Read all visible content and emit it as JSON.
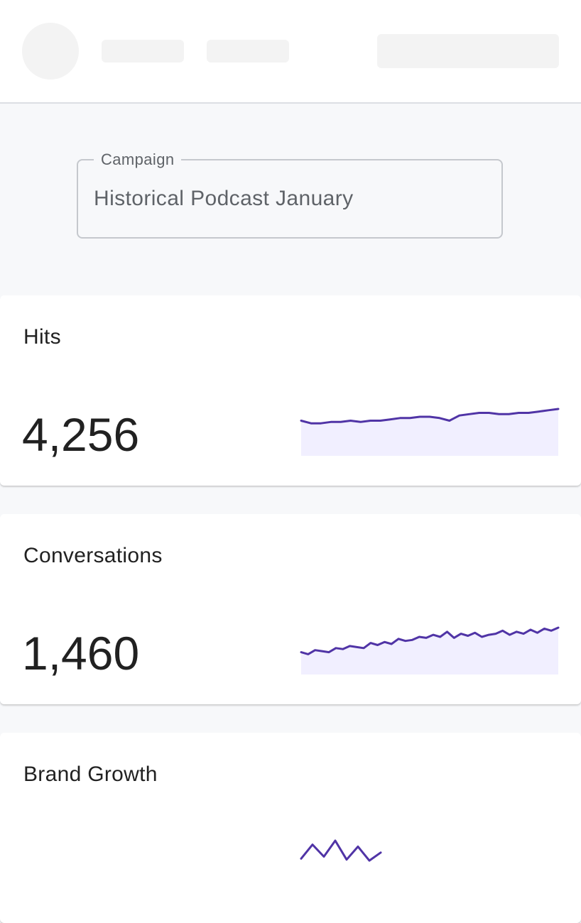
{
  "campaign_field": {
    "label": "Campaign",
    "value": "Historical Podcast January"
  },
  "accent_color": "#5034a6",
  "area_fill_color": "#f1efff",
  "metrics": [
    {
      "title": "Hits",
      "value": "4,256",
      "trend": [
        22,
        20,
        20,
        21,
        21,
        22,
        21,
        22,
        22,
        23,
        24,
        24,
        25,
        25,
        24,
        22,
        26,
        27,
        28,
        28,
        27,
        27,
        28,
        28,
        29,
        30,
        31
      ]
    },
    {
      "title": "Conversations",
      "value": "1,460",
      "trend": [
        10,
        8,
        12,
        11,
        10,
        14,
        13,
        16,
        15,
        14,
        19,
        17,
        20,
        18,
        23,
        21,
        22,
        25,
        24,
        27,
        25,
        30,
        24,
        28,
        26,
        29,
        25,
        27,
        28,
        31,
        27,
        30,
        28,
        32,
        29,
        33,
        31,
        34
      ]
    },
    {
      "title": "Brand Growth",
      "value": "",
      "trend": [
        6,
        20,
        8,
        24,
        5,
        18,
        4,
        12
      ]
    }
  ]
}
